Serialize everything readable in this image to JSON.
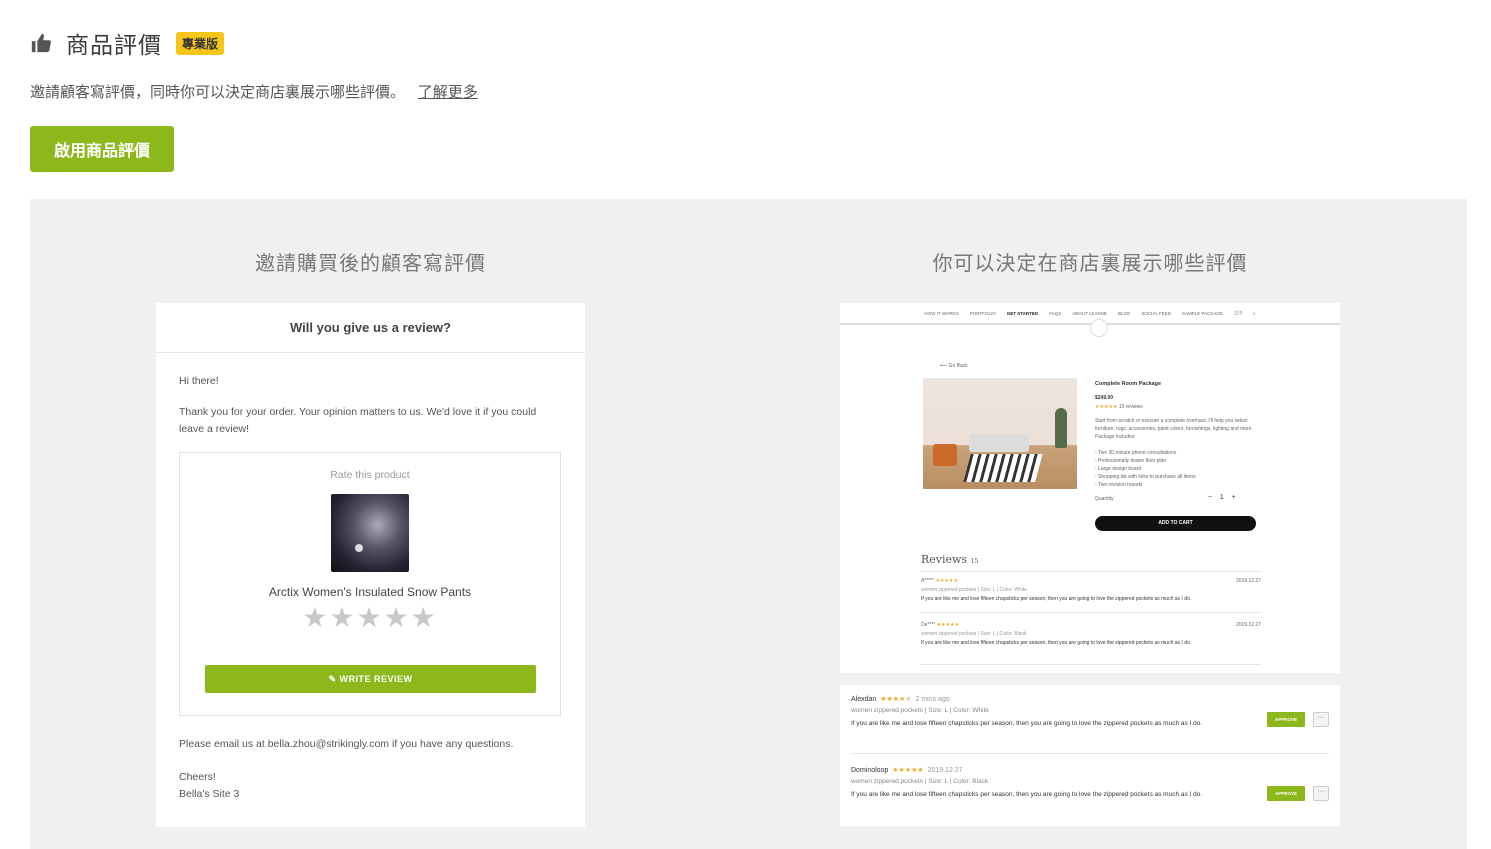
{
  "header": {
    "title": "商品評價",
    "badge": "專業版"
  },
  "description": {
    "text": "邀請顧客寫評價，同時你可以決定商店裏展示哪些評價。",
    "link": "了解更多"
  },
  "enable_button": "啟用商品評價",
  "left": {
    "title": "邀請購買後的顧客寫評價",
    "email": {
      "heading": "Will you give us a review?",
      "greeting": "Hi there!",
      "body": "Thank you for your order. Your opinion matters to us. We'd love it if you could leave a review!",
      "rate_label": "Rate this product",
      "product_name": "Arctix Women's Insulated Snow Pants",
      "stars": "★★★★★",
      "write_review": "✎ WRITE REVIEW",
      "footer": "Please email us at bella.zhou@strikingly.com if you have any questions.",
      "signoff": "Cheers!",
      "signature": "Bella's Site 3"
    }
  },
  "right": {
    "title": "你可以決定在商店裏展示哪些評價",
    "shop": {
      "nav": [
        "HOW IT WORKS",
        "PORTFOLIO",
        "GET STARTED",
        "FAQS",
        "ABOUT LEANNE",
        "BLOG",
        "SOCIAL FEED",
        "SAMPLE PACKAGE",
        "🛒0",
        "⌕"
      ],
      "back": "⟵ Go Back",
      "product_title": "Complete Room Package",
      "price": "$249.00",
      "rating": "★★★★★",
      "reviews_count": "15 reviews",
      "details": "Start from scratch or execute a complete overhaul. I'll help you select furniture, rugs, accessories, paint colors, furnishings, lighting and more. Package includes:",
      "bullets": [
        "- Two 30 minute phone consultations",
        "- Professionally drawn floor plan",
        "- Large design board",
        "- Shopping list with links to purchase all items",
        "- Two revision rounds"
      ],
      "quantity_label": "Quantity",
      "quantity": "1",
      "add_to_cart": "ADD TO CART",
      "reviews_title": "Reviews",
      "reviews_total": "15",
      "reviews": [
        {
          "name": "A*****",
          "stars": "★★★★★",
          "date": "2019.12.27",
          "meta": "women zippered pockets  |  Size: L  |  Color: White",
          "text": "If you are like me and lose fifteen chapsticks per season, then you are going to love the zippered pockets as much as I do."
        },
        {
          "name": "De****",
          "stars": "★★★★★",
          "date": "2019.12.27",
          "meta": "women zippered pockets  |  Size: L  |  Color: Black",
          "text": "If you are like me and lose fifteen chapsticks per season, then you are going to love the zippered pockets as much as I do."
        }
      ]
    },
    "approvals": [
      {
        "name": "Alexdan",
        "stars": "★★★★",
        "stars_off": "★",
        "when": "2 mins ago",
        "meta": "women zippered pockets  |  Size: L  |  Color: White",
        "text": "If you are like me and lose fifteen chapsticks per season, then you are going to love the zippered pockets as much as I do.",
        "approve": "APPROVE",
        "more": "···"
      },
      {
        "name": "Dominoloop",
        "stars": "★★★★★",
        "stars_off": "",
        "when": "2019.12.27",
        "meta": "women zippered pockets  |  Size: L  |  Color: Black",
        "text": "If you are like me and lose fifteen chapsticks per season, then you are going to love the zippered pockets as much as I do.",
        "approve": "APPROVE",
        "more": "···"
      }
    ]
  },
  "colors": {
    "accent": "#8cb81c",
    "badge": "#f5c518",
    "panel": "#f0f0f0",
    "star": "#f5a623"
  }
}
